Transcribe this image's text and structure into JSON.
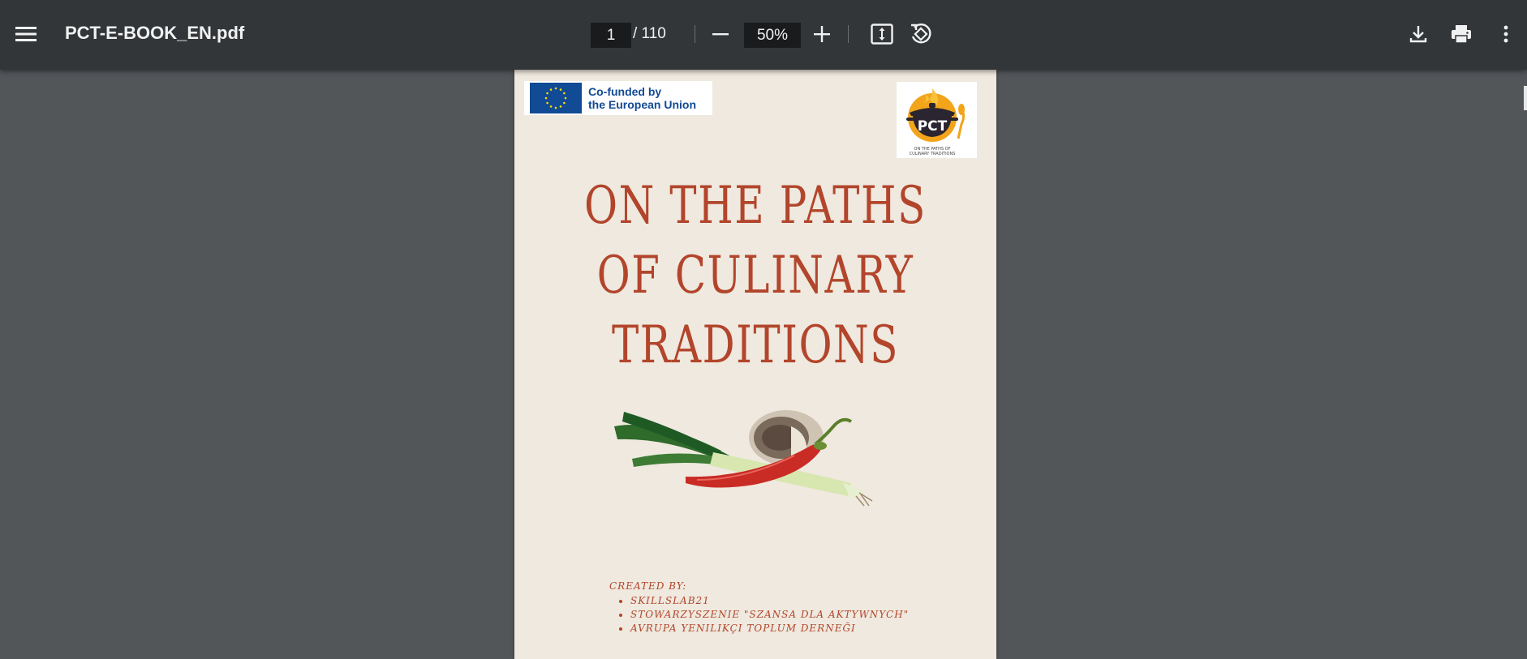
{
  "toolbar": {
    "file_name": "PCT-E-BOOK_EN.pdf",
    "current_page": "1",
    "page_total": "/ 110",
    "zoom": "50%"
  },
  "icons": {
    "menu": "hamburger-menu-icon",
    "zoom_out": "minus-icon",
    "zoom_in": "plus-icon",
    "fit": "fit-to-page-icon",
    "rotate": "rotate-icon",
    "download": "download-icon",
    "print": "printer-icon",
    "more": "vertical-dots-icon"
  },
  "document": {
    "eu_logo_text_line1": "Co-funded by",
    "eu_logo_text_line2": "the European Union",
    "pct_logo_text": "PCT",
    "pct_logo_caption_line1": "ON THE PATHS OF",
    "pct_logo_caption_line2": "CULINARY TRADITIONS",
    "title_lines": [
      "ON THE PATHS",
      "OF CULINARY",
      "TRADITIONS"
    ],
    "created_by": "CREATED BY:",
    "creators": [
      "SKILLSLAB21",
      "STOWARZYSZENIE \"SZANSA DLA AKTYWNYCH\"",
      "AVRUPA YENILIKÇI TOPLUM DERNEĞI"
    ]
  },
  "colors": {
    "toolbar_bg": "#323639",
    "viewer_bg": "#525659",
    "page_bg": "#efe9df",
    "title_color": "#b2452b",
    "eu_blue": "#114a95"
  }
}
